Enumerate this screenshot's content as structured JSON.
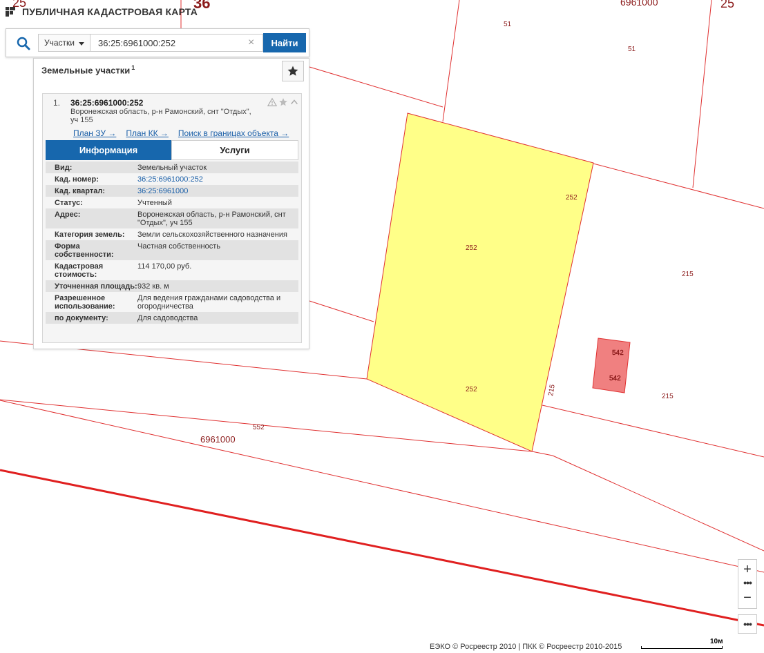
{
  "app": {
    "title": "ПУБЛИЧНАЯ КАДАСТРОВАЯ КАРТА"
  },
  "search": {
    "type_label": "Участки",
    "value": "36:25:6961000:252",
    "clear_icon": "×",
    "submit_label": "Найти"
  },
  "panel": {
    "title": "Земельные участки",
    "count": "1",
    "result": {
      "index": "1.",
      "cadnum": "36:25:6961000:252",
      "address_line1": "Воронежская область, р-н Рамонский, снт \"Отдых\",",
      "address_line2": "уч 155",
      "links": [
        "План ЗУ →",
        "План КК →",
        "Поиск в границах объекта →"
      ],
      "tabs": [
        "Информация",
        "Услуги"
      ],
      "info": [
        {
          "key": "Вид:",
          "value": "Земельный участок"
        },
        {
          "key": "Кад. номер:",
          "value": "36:25:6961000:252"
        },
        {
          "key": "Кад. квартал:",
          "value": "36:25:6961000"
        },
        {
          "key": "Статус:",
          "value": "Учтенный"
        },
        {
          "key": "Адрес:",
          "value": "Воронежская область, р-н Рамонский, снт \"Отдых\", уч 155"
        },
        {
          "key": "Категория земель:",
          "value": "Земли сельскохозяйственного назначения"
        },
        {
          "key": "Форма собственности:",
          "value": "Частная собственность"
        },
        {
          "key": "Кадастровая стоимость:",
          "value": "114 170,00 руб."
        },
        {
          "key": "Уточненная площадь:",
          "value": "932 кв. м"
        },
        {
          "key": "Разрешенное использование:",
          "value": "Для ведения гражданами садоводства и огородничества"
        },
        {
          "key": "по документу:",
          "value": "Для садоводства"
        }
      ]
    }
  },
  "map": {
    "labels": {
      "region_25_left": "25",
      "region_36": "36",
      "quarter_top": "6961000",
      "region_25_right": "25",
      "plot_51_a": "51",
      "plot_51_b": "51",
      "plot_252_a": "252",
      "plot_252_b": "252",
      "plot_252_c": "252",
      "plot_215_a": "215",
      "plot_215_b": "215",
      "plot_215_c": "215",
      "plot_542_a": "542",
      "plot_542_b": "542",
      "plot_552": "552",
      "quarter_bottom": "6961000"
    },
    "colors": {
      "boundary": "#e03030",
      "selected_fill": "#ffff88",
      "building_fill": "#f08080",
      "label": "#8b1a1a",
      "accent": "#1767ad"
    }
  },
  "controls": {
    "zoom_in": "+",
    "zoom_out": "−",
    "more": "•••"
  },
  "footer": {
    "copyright": "ЕЭКО © Росреестр 2010 | ПКК © Росреестр 2010-2015",
    "scale": "10м"
  }
}
